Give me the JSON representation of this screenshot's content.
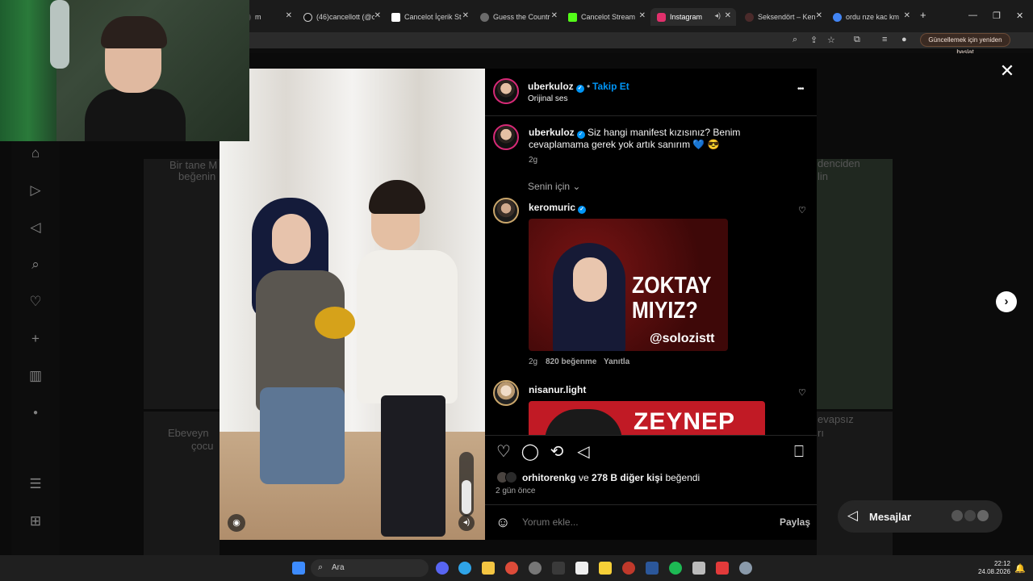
{
  "browser": {
    "tabs": [
      {
        "label": "m",
        "color": "#444444",
        "active": false
      },
      {
        "label": "(46)cancellott (@c",
        "color": "#111111",
        "active": false
      },
      {
        "label": "Cancelot İçerik St",
        "color": "#ffffff",
        "active": false
      },
      {
        "label": "Guess the Countr",
        "color": "#6b6b6b",
        "active": false
      },
      {
        "label": "Cancelot Stream",
        "color": "#53fc18",
        "active": false
      },
      {
        "label": "Instagram",
        "color": "#e1306c",
        "active": true
      },
      {
        "label": "Seksendört – Ken",
        "color": "#4a2a2a",
        "active": false
      },
      {
        "label": "ordu nze kac km",
        "color": "#4285f4",
        "active": false
      }
    ],
    "new_tab": "+",
    "update_button": "Güncellemek için yeniden başlat"
  },
  "post": {
    "author": "uberkuloz",
    "follow": "Takip Et",
    "audio": "Orijinal ses",
    "more": "•••",
    "caption_user": "uberkuloz",
    "caption_text": "Siz hangi manifest kızısınız? Benim cevaplamama gerek yok artık sanırım 💙 😎",
    "caption_time": "2g",
    "filter": "Senin için",
    "comments": [
      {
        "user": "keromuric",
        "verified": true,
        "time": "2g",
        "likes": "820 beğenme",
        "reply": "Yanıtla",
        "image_text": "ZOKTAY MIYIZ?",
        "image_tag": "@solozistt"
      },
      {
        "user": "nisanur.light",
        "verified": false,
        "image_text": "ZEYNEP"
      }
    ],
    "liked_by_user": "orhitorenkg",
    "liked_by_rest": "ve",
    "liked_by_count": "278 B diğer kişi",
    "liked_suffix": "beğendi",
    "age": "2 gün önce",
    "comment_placeholder": "Yorum ekle...",
    "post_button": "Paylaş"
  },
  "background": {
    "left_text_1": "Bir tane M",
    "left_text_2": "beğenin",
    "left_text_3": "Ebeveyn",
    "left_text_4": "çocu",
    "right_text_1": "denciden",
    "right_text_2": "lin",
    "right_text_3": "evapsız",
    "right_text_4": "rı"
  },
  "messages": {
    "label": "Mesajlar"
  },
  "taskbar": {
    "search": "Ara",
    "time": "22:12",
    "date": "24.08.2026"
  }
}
